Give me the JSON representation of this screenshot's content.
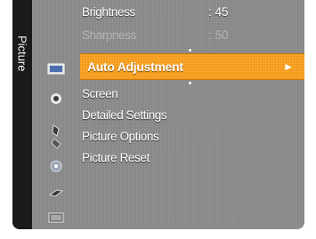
{
  "sidebar": {
    "title": "Picture",
    "icons": [
      "picture-icon",
      "sound-icon",
      "setup-icon",
      "input-icon",
      "application-icon",
      "support-icon",
      "more-icon"
    ]
  },
  "menu": {
    "rows": [
      {
        "label": "Brightness",
        "value": ": 45",
        "enabled": true
      },
      {
        "label": "Sharpness",
        "value": ": 50",
        "enabled": false
      }
    ],
    "selected": {
      "label": "Auto Adjustment",
      "arrow": "►"
    },
    "items": [
      "Screen",
      "Detailed Settings",
      "Picture Options",
      "Picture Reset"
    ]
  },
  "colors": {
    "accent": "#f39b1b",
    "panel": "#888888",
    "sidebar": "#1a1a1a"
  }
}
